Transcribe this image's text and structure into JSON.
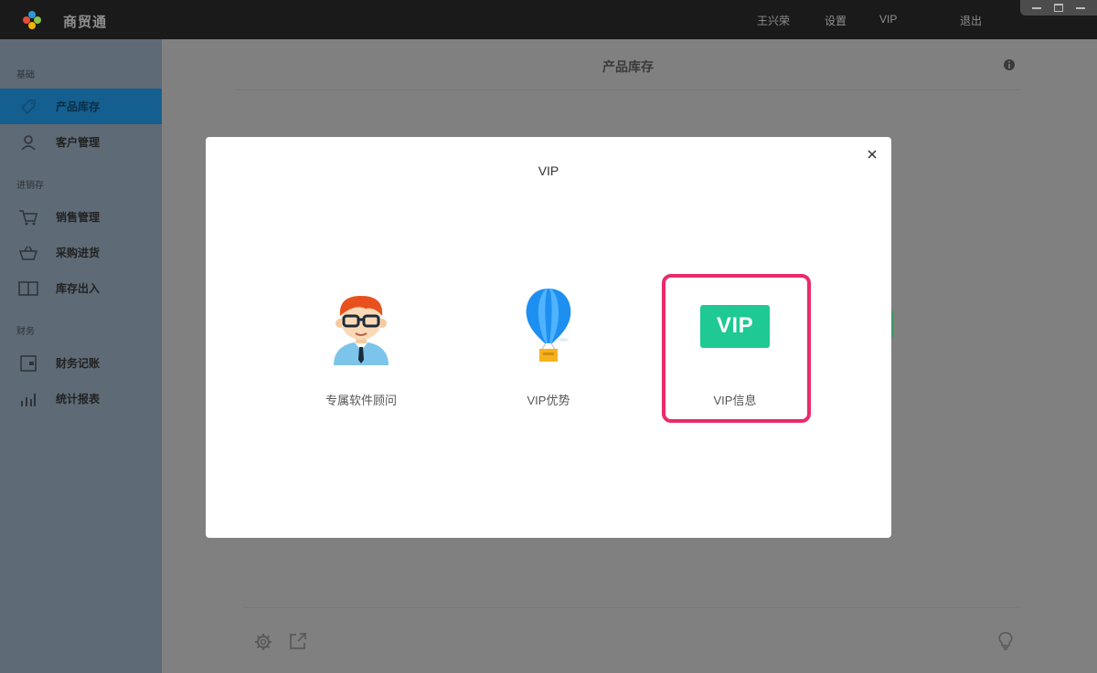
{
  "app": {
    "name": "商贸通"
  },
  "topnav": {
    "user": "王兴荣",
    "settings": "设置",
    "vip": "VIP",
    "logout": "退出"
  },
  "sidebar": {
    "sections": [
      "基础",
      "进销存",
      "财务"
    ],
    "items": [
      {
        "label": "产品库存",
        "icon": "tag-icon",
        "active": true
      },
      {
        "label": "客户管理",
        "icon": "user-icon"
      },
      {
        "label": "销售管理",
        "icon": "cart-icon"
      },
      {
        "label": "采购进货",
        "icon": "basket-icon"
      },
      {
        "label": "库存出入",
        "icon": "book-icon"
      },
      {
        "label": "财务记账",
        "icon": "wallet-icon"
      },
      {
        "label": "统计报表",
        "icon": "bar-chart-icon"
      }
    ]
  },
  "main": {
    "title": "产品库存"
  },
  "modal": {
    "title": "VIP",
    "cards": [
      {
        "label": "专属软件顾问",
        "icon": "advisor-avatar-icon"
      },
      {
        "label": "VIP优势",
        "icon": "hot-air-balloon-icon"
      },
      {
        "label": "VIP信息",
        "icon": "vip-badge-icon",
        "badge": "VIP",
        "highlighted": true
      }
    ]
  },
  "colors": {
    "accent_highlight": "#ea2a6c",
    "vip_green": "#1ec993",
    "active_nav": "#145f8f"
  }
}
